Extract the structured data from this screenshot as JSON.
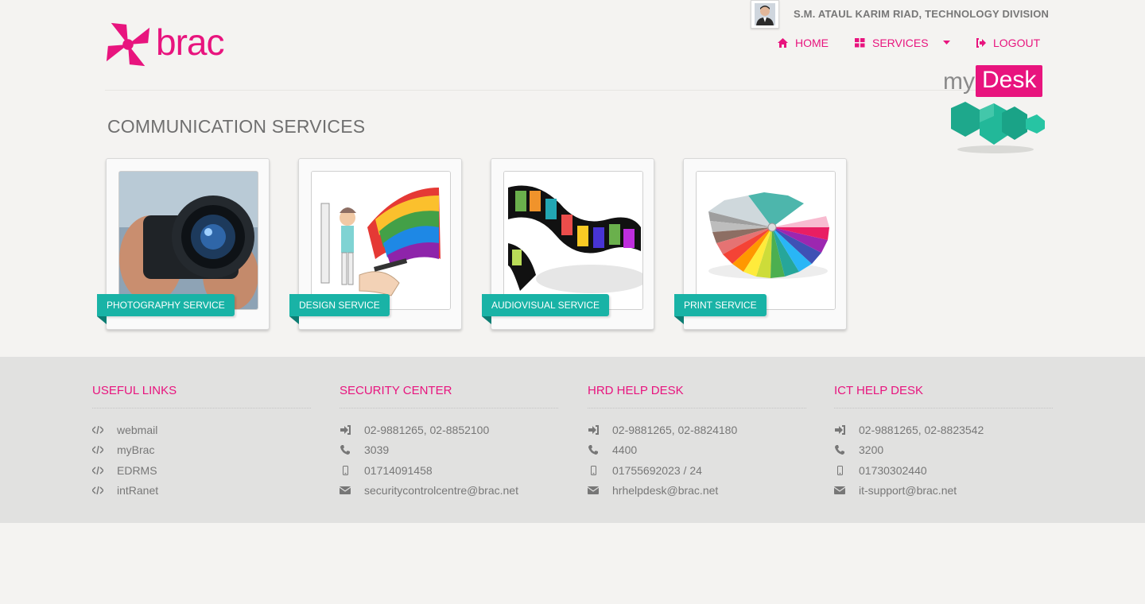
{
  "brand": {
    "name": "brac",
    "color": "#e8147e"
  },
  "user": {
    "name": "S.M. ATAUL KARIM RIAD, TECHNOLOGY DIVISION",
    "avatar_icon": "user-avatar"
  },
  "nav": [
    {
      "label": "HOME",
      "icon": "home-icon"
    },
    {
      "label": "SERVICES",
      "icon": "grid-icon",
      "dropdown": true
    },
    {
      "label": "LOGOUT",
      "icon": "logout-icon"
    }
  ],
  "mydesk": {
    "prefix": "my",
    "highlight": "Desk"
  },
  "page": {
    "title": "COMMUNICATION SERVICES"
  },
  "services": [
    {
      "label": "PHOTOGRAPHY SERVICE",
      "image": "camera-lens"
    },
    {
      "label": "DESIGN SERVICE",
      "image": "designer-illustration"
    },
    {
      "label": "AUDIOVISUAL SERVICE",
      "image": "film-strip"
    },
    {
      "label": "PRINT SERVICE",
      "image": "color-swatch-fan"
    }
  ],
  "footer": {
    "useful_links": {
      "title": "USEFUL LINKS",
      "items": [
        "webmail",
        "myBrac",
        "EDRMS",
        "intRanet"
      ]
    },
    "security": {
      "title": "SECURITY CENTER",
      "items": [
        "02-9881265, 02-8852100",
        "3039",
        "01714091458",
        "securitycontrolcentre@brac.net"
      ]
    },
    "hrd": {
      "title": "HRD HELP DESK",
      "items": [
        "02-9881265, 02-8824180",
        "4400",
        "01755692023 / 24",
        "hrhelpdesk@brac.net"
      ]
    },
    "ict": {
      "title": "ICT HELP DESK",
      "items": [
        "02-9881265, 02-8823542",
        "3200",
        "01730302440",
        "it-support@brac.net"
      ]
    }
  },
  "colors": {
    "accent": "#e8147e",
    "teal": "#19b3a6",
    "footer_bg": "#e1e1e0"
  }
}
